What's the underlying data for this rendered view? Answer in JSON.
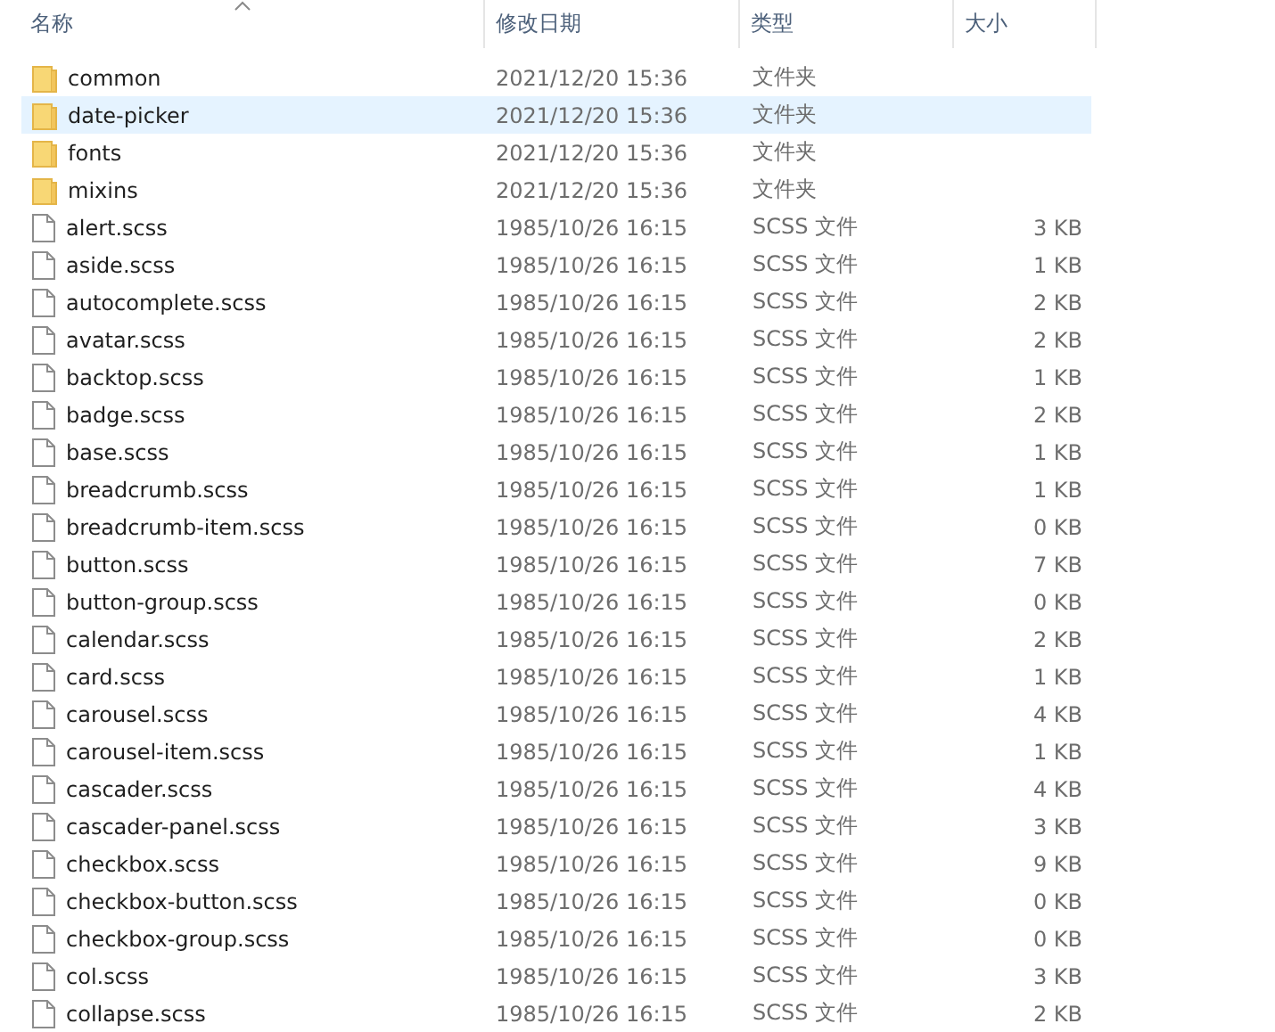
{
  "columns": [
    {
      "label": "名称",
      "sorted": true
    },
    {
      "label": "修改日期",
      "sorted": false
    },
    {
      "label": "类型",
      "sorted": false
    },
    {
      "label": "大小",
      "sorted": false
    }
  ],
  "files": [
    {
      "name": "common",
      "kind": "folder",
      "modified": "2021/12/20 15:36",
      "type": "文件夹",
      "selected": false
    },
    {
      "name": "date-picker",
      "kind": "folder",
      "modified": "2021/12/20 15:36",
      "type": "文件夹",
      "selected": true
    },
    {
      "name": "fonts",
      "kind": "folder",
      "modified": "2021/12/20 15:36",
      "type": "文件夹",
      "selected": false
    },
    {
      "name": "mixins",
      "kind": "folder",
      "modified": "2021/12/20 15:36",
      "type": "文件夹",
      "selected": false
    },
    {
      "name": "alert.scss",
      "kind": "file",
      "modified": "1985/10/26 16:15",
      "type": "SCSS 文件",
      "size": "3 KB",
      "selected": false
    },
    {
      "name": "aside.scss",
      "kind": "file",
      "modified": "1985/10/26 16:15",
      "type": "SCSS 文件",
      "size": "1 KB",
      "selected": false
    },
    {
      "name": "autocomplete.scss",
      "kind": "file",
      "modified": "1985/10/26 16:15",
      "type": "SCSS 文件",
      "size": "2 KB",
      "selected": false
    },
    {
      "name": "avatar.scss",
      "kind": "file",
      "modified": "1985/10/26 16:15",
      "type": "SCSS 文件",
      "size": "2 KB",
      "selected": false
    },
    {
      "name": "backtop.scss",
      "kind": "file",
      "modified": "1985/10/26 16:15",
      "type": "SCSS 文件",
      "size": "1 KB",
      "selected": false
    },
    {
      "name": "badge.scss",
      "kind": "file",
      "modified": "1985/10/26 16:15",
      "type": "SCSS 文件",
      "size": "2 KB",
      "selected": false
    },
    {
      "name": "base.scss",
      "kind": "file",
      "modified": "1985/10/26 16:15",
      "type": "SCSS 文件",
      "size": "1 KB",
      "selected": false
    },
    {
      "name": "breadcrumb.scss",
      "kind": "file",
      "modified": "1985/10/26 16:15",
      "type": "SCSS 文件",
      "size": "1 KB",
      "selected": false
    },
    {
      "name": "breadcrumb-item.scss",
      "kind": "file",
      "modified": "1985/10/26 16:15",
      "type": "SCSS 文件",
      "size": "0 KB",
      "selected": false
    },
    {
      "name": "button.scss",
      "kind": "file",
      "modified": "1985/10/26 16:15",
      "type": "SCSS 文件",
      "size": "7 KB",
      "selected": false
    },
    {
      "name": "button-group.scss",
      "kind": "file",
      "modified": "1985/10/26 16:15",
      "type": "SCSS 文件",
      "size": "0 KB",
      "selected": false
    },
    {
      "name": "calendar.scss",
      "kind": "file",
      "modified": "1985/10/26 16:15",
      "type": "SCSS 文件",
      "size": "2 KB",
      "selected": false
    },
    {
      "name": "card.scss",
      "kind": "file",
      "modified": "1985/10/26 16:15",
      "type": "SCSS 文件",
      "size": "1 KB",
      "selected": false
    },
    {
      "name": "carousel.scss",
      "kind": "file",
      "modified": "1985/10/26 16:15",
      "type": "SCSS 文件",
      "size": "4 KB",
      "selected": false
    },
    {
      "name": "carousel-item.scss",
      "kind": "file",
      "modified": "1985/10/26 16:15",
      "type": "SCSS 文件",
      "size": "1 KB",
      "selected": false
    },
    {
      "name": "cascader.scss",
      "kind": "file",
      "modified": "1985/10/26 16:15",
      "type": "SCSS 文件",
      "size": "4 KB",
      "selected": false
    },
    {
      "name": "cascader-panel.scss",
      "kind": "file",
      "modified": "1985/10/26 16:15",
      "type": "SCSS 文件",
      "size": "3 KB",
      "selected": false
    },
    {
      "name": "checkbox.scss",
      "kind": "file",
      "modified": "1985/10/26 16:15",
      "type": "SCSS 文件",
      "size": "9 KB",
      "selected": false
    },
    {
      "name": "checkbox-button.scss",
      "kind": "file",
      "modified": "1985/10/26 16:15",
      "type": "SCSS 文件",
      "size": "0 KB",
      "selected": false
    },
    {
      "name": "checkbox-group.scss",
      "kind": "file",
      "modified": "1985/10/26 16:15",
      "type": "SCSS 文件",
      "size": "0 KB",
      "selected": false
    },
    {
      "name": "col.scss",
      "kind": "file",
      "modified": "1985/10/26 16:15",
      "type": "SCSS 文件",
      "size": "3 KB",
      "selected": false
    },
    {
      "name": "collapse.scss",
      "kind": "file",
      "modified": "1985/10/26 16:15",
      "type": "SCSS 文件",
      "size": "2 KB",
      "selected": false
    }
  ]
}
